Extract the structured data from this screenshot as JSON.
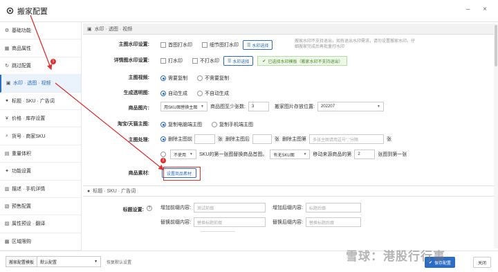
{
  "window": {
    "title": "搬家配置",
    "controls": "– ×"
  },
  "sidebar": {
    "items": [
      {
        "label": "基础功能",
        "icon": "gear-icon",
        "glyph": "⚙"
      },
      {
        "label": "商品属性",
        "icon": "grid-icon",
        "glyph": "▦"
      },
      {
        "label": "跳过配置",
        "icon": "skip-icon",
        "glyph": "↻"
      },
      {
        "label": "水印 · 透图 · 视频",
        "icon": "image-icon",
        "glyph": "▣",
        "active": true
      },
      {
        "label": "标题 · SKU · 广告词",
        "icon": "tag-icon",
        "glyph": "●"
      },
      {
        "label": "价格 · 库存设置",
        "icon": "price-icon",
        "glyph": "¥"
      },
      {
        "label": "货号 · 商家SKU",
        "icon": "code-icon",
        "glyph": "⌕"
      },
      {
        "label": "重量体积",
        "icon": "weight-icon",
        "glyph": "▤"
      },
      {
        "label": "功能设置",
        "icon": "function-icon",
        "glyph": "✦"
      },
      {
        "label": "描述 · 手机详情",
        "icon": "description-icon",
        "glyph": "▥"
      },
      {
        "label": "预售配置",
        "icon": "presale-icon",
        "glyph": "▧"
      },
      {
        "label": "属性预设 · 翻译",
        "icon": "translate-icon",
        "glyph": "▨"
      },
      {
        "label": "区域限购",
        "icon": "region-icon",
        "glyph": "▩"
      }
    ]
  },
  "section1": {
    "title": "水印 · 透图 · 视频",
    "main_watermark": {
      "label": "主图水印设置:",
      "opt1": "首图打水印",
      "opt2": "细节图打水印",
      "button": "水印选择",
      "hint1": "搬家水印不支持退出，如有退出水印需求，请勿设置搬家水印。仔",
      "hint2": "细搬家完成后再批量打水印"
    },
    "detail_watermark": {
      "label": "详情图水印设置:",
      "opt1": "打水印",
      "opt2": "不打水印",
      "button": "水印选择",
      "status": "已选择水印模板（搬家水印不支持退出）"
    },
    "main_video": {
      "label": "主图视频:",
      "opt1": "需要复制",
      "opt2": "不需要复制"
    },
    "transparent": {
      "label": "生成透明图:",
      "opt1": "自动生成",
      "opt2": "不自动生成"
    },
    "product_images": {
      "label": "商品图片:",
      "select": "用SKU图替换主图",
      "min_label": "商品图至少张数:",
      "min_value": "3",
      "pos_label": "搬家图片存放位置:",
      "pos_select": "202207"
    },
    "taobao_main": {
      "label": "淘宝/天猫主图:",
      "opt1": "复制电脑端主图",
      "opt2": "复制手机端主图"
    },
    "main_process": {
      "label": "主图处理:",
      "del_front": "删除主图前",
      "unit1": "张",
      "del_back": "删除主图后",
      "unit2": "张",
      "del_main": "删除主图第",
      "placeholder": "多张主图请用逗号\",\"分隔",
      "unit3": "张"
    },
    "sku_replace": {
      "select": "不使用",
      "text1": "SKU的第一张图替换商品首图。",
      "select2": "有无SKU图",
      "text2": "移动来源商品的第",
      "value": "2",
      "text3": "张图到第一张"
    },
    "material": {
      "label": "商品素材:",
      "button": "设置商品素材"
    }
  },
  "section2": {
    "title": "标题 · SKU · 广告词",
    "title_settings": {
      "label": "标题设置:",
      "help": "?",
      "prefix_label": "增加前缀内容:",
      "prefix_placeholder": "测试前缀",
      "suffix_label": "增加后缀内容:",
      "suffix_placeholder": "标题后缀",
      "replace_before_label": "替换前缀内容:",
      "replace_before_placeholder": "替换标题前缀",
      "replace_after_label": "替换后缀内容:",
      "replace_after_placeholder": "替换标题后缀"
    }
  },
  "markers": {
    "m1": "1",
    "m2": "2"
  },
  "footer": {
    "template_label": "搬家配置模板",
    "template_value": "默认配置",
    "restore": "恢复默认设置",
    "save": "保存配置",
    "close": "关闭"
  },
  "watermark_text": "雪球：港股行行事",
  "colors": {
    "accent": "#2b6cc4",
    "annotation": "#e03030"
  }
}
